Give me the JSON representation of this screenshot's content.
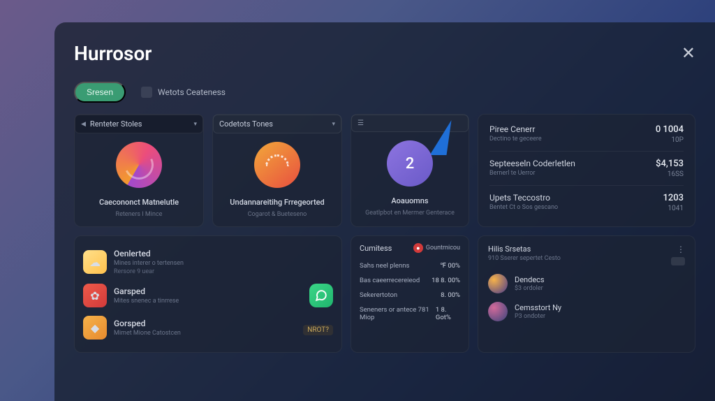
{
  "header": {
    "title": "Hurrosor"
  },
  "tabs": {
    "pill_label": "Sresen",
    "tab2_label": "Wetots Ceateness"
  },
  "cards": {
    "a": {
      "head": "Renteter Stoles",
      "title": "Caecononct Matnelutle",
      "sub": "Reteners I Mince"
    },
    "b": {
      "head": "Codetots Tones",
      "title": "Undannareitihg Frregeorted",
      "sub": "Cogarot & Bueteseno"
    },
    "c": {
      "value": "2",
      "title": "Aoauomns",
      "sub": "Geatlpbot en Mermer Genterace"
    }
  },
  "stats": [
    {
      "label": "Piree Cenerr",
      "sub": "Dectino te geceere",
      "value": "0 1004",
      "vsub": "10P"
    },
    {
      "label": "Septeeseln Coderletlen",
      "sub": "Bernerl te Uerror",
      "value": "$4,153",
      "vsub": "16SS"
    },
    {
      "label": "Upets Teccostro",
      "sub": "Bentet Ct o Sos gescano",
      "value": "1203",
      "vsub": "1041"
    }
  ],
  "apps": [
    {
      "title": "Oenlerted",
      "sub": "Mines interer o tertensen",
      "sub2": "Rersore 9 uear"
    },
    {
      "title": "Garsped",
      "sub": "Mites snenec a tinrrese",
      "sub2": ""
    },
    {
      "title": "Gorsped",
      "sub": "Mimet Mione Catostcen",
      "sub2": "",
      "badge": "NROT?"
    }
  ],
  "metrics": {
    "head": "Cumitess",
    "badge_label": "Gountrnicou",
    "rows": [
      {
        "label": "Sahs neel plenns",
        "value": "℉ 00%"
      },
      {
        "label": "Bas caeerrecereieod",
        "value": "18  8. 00%"
      },
      {
        "label": "Sekerertoton",
        "value": "8. 00%"
      },
      {
        "label": "Seneners or antece   781  Miop",
        "value": "1 8. Got%"
      }
    ]
  },
  "people": {
    "head": "Hilis Srsetas",
    "sub": "910 Sserer sepertet Cesto",
    "persons": [
      {
        "name": "Dendecs",
        "sub": "$3 ordoler"
      },
      {
        "name": "Cemsstort Ny",
        "sub": "P3 ondoter"
      }
    ]
  }
}
